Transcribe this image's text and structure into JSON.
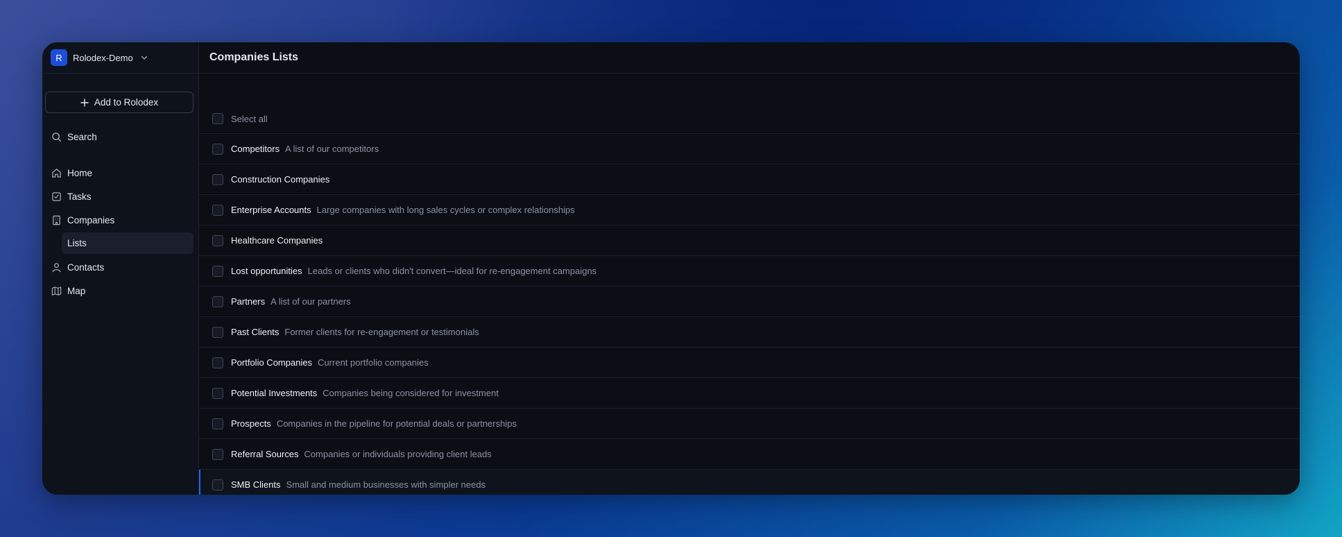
{
  "workspace": {
    "initial": "R",
    "name": "Rolodex-Demo"
  },
  "sidebar": {
    "add_label": "Add to Rolodex",
    "search_label": "Search",
    "items": [
      {
        "label": "Home",
        "icon": "home-icon"
      },
      {
        "label": "Tasks",
        "icon": "tasks-icon"
      },
      {
        "label": "Companies",
        "icon": "building-icon"
      },
      {
        "label": "Contacts",
        "icon": "user-icon"
      },
      {
        "label": "Map",
        "icon": "map-icon"
      }
    ],
    "sub_item": {
      "label": "Lists"
    }
  },
  "header": {
    "title": "Companies Lists"
  },
  "list": {
    "select_all_label": "Select all",
    "rows": [
      {
        "name": "Competitors",
        "description": "A list of our competitors"
      },
      {
        "name": "Construction Companies",
        "description": ""
      },
      {
        "name": "Enterprise Accounts",
        "description": "Large companies with long sales cycles or complex relationships"
      },
      {
        "name": "Healthcare Companies",
        "description": ""
      },
      {
        "name": "Lost opportunities",
        "description": "Leads or clients who didn't convert—ideal for re-engagement campaigns"
      },
      {
        "name": "Partners",
        "description": "A list of our partners"
      },
      {
        "name": "Past Clients",
        "description": "Former clients for re-engagement or testimonials"
      },
      {
        "name": "Portfolio Companies",
        "description": "Current portfolio companies"
      },
      {
        "name": "Potential Investments",
        "description": "Companies being considered for investment"
      },
      {
        "name": "Prospects",
        "description": "Companies in the pipeline for potential deals or partnerships"
      },
      {
        "name": "Referral Sources",
        "description": "Companies or individuals providing client leads"
      },
      {
        "name": "SMB Clients",
        "description": "Small and medium businesses with simpler needs"
      }
    ]
  },
  "colors": {
    "accent": "#1d4ed8",
    "active_indicator": "#2563eb",
    "window_bg": "#0b0e14",
    "sidebar_bg": "#0e121b"
  }
}
